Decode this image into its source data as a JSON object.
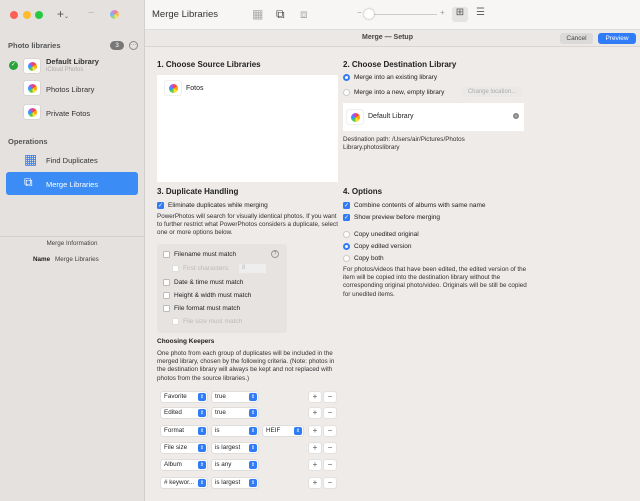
{
  "window": {
    "title": "Merge Libraries",
    "subtitle": "Merge — Setup",
    "cancel": "Cancel",
    "preview": "Preview"
  },
  "sidebar": {
    "libraries_header": "Photo libraries",
    "library_count": "3",
    "libraries": [
      {
        "name": "Default Library",
        "sub": "iCloud Photos"
      },
      {
        "name": "Photos Library"
      },
      {
        "name": "Private Fotos"
      }
    ],
    "operations_header": "Operations",
    "operations": [
      "Find Duplicates",
      "Merge Libraries"
    ],
    "info_header": "Merge Information",
    "name_label": "Name",
    "name_value": "Merge Libraries"
  },
  "source": {
    "title": "1. Choose Source Libraries",
    "libraries": [
      "Fotos"
    ]
  },
  "destination": {
    "title": "2. Choose Destination Library",
    "opt_existing": "Merge into an existing library",
    "opt_new": "Merge into a new, empty library",
    "change_location": "Change location...",
    "library": "Default Library",
    "path": "Destination path: /Users/air/Pictures/Photos Library.photoslibrary"
  },
  "duplicates": {
    "title": "3. Duplicate Handling",
    "eliminate": "Eliminate duplicates while merging",
    "description": "PowerPhotos will search for visually identical photos. If you want to further restrict what PowerPhotos considers a duplicate, select one or more options below.",
    "filename": "Filename must match",
    "first_chars": "First characters:",
    "first_chars_value": "8",
    "datetime": "Date & time must match",
    "dimensions": "Height & width must match",
    "format": "File format must match",
    "filesize": "File size must match",
    "keepers_title": "Choosing Keepers",
    "keepers_desc": "One photo from each group of duplicates will be included in the merged library, chosen by the following criteria. (Note: photos in the destination library will always be kept and not replaced with photos from the source libraries.)",
    "rules": [
      {
        "field": "Favorite",
        "op": "true"
      },
      {
        "field": "Edited",
        "op": "true"
      },
      {
        "field": "Format",
        "op": "is",
        "value": "HEIF"
      },
      {
        "field": "File size",
        "op": "is largest"
      },
      {
        "field": "Album",
        "op": "is any"
      },
      {
        "field": "# keywor...",
        "op": "is largest"
      }
    ]
  },
  "options": {
    "title": "4. Options",
    "combine": "Combine contents of albums with same name",
    "show_preview": "Show preview before merging",
    "copy_unedited": "Copy unedited original",
    "copy_edited": "Copy edited version",
    "copy_both": "Copy both",
    "description": "For photos/videos that have been edited, the edited version of the item will be copied into the destination library without the corresponding original photo/video. Originals will be still be copied for unedited items."
  }
}
